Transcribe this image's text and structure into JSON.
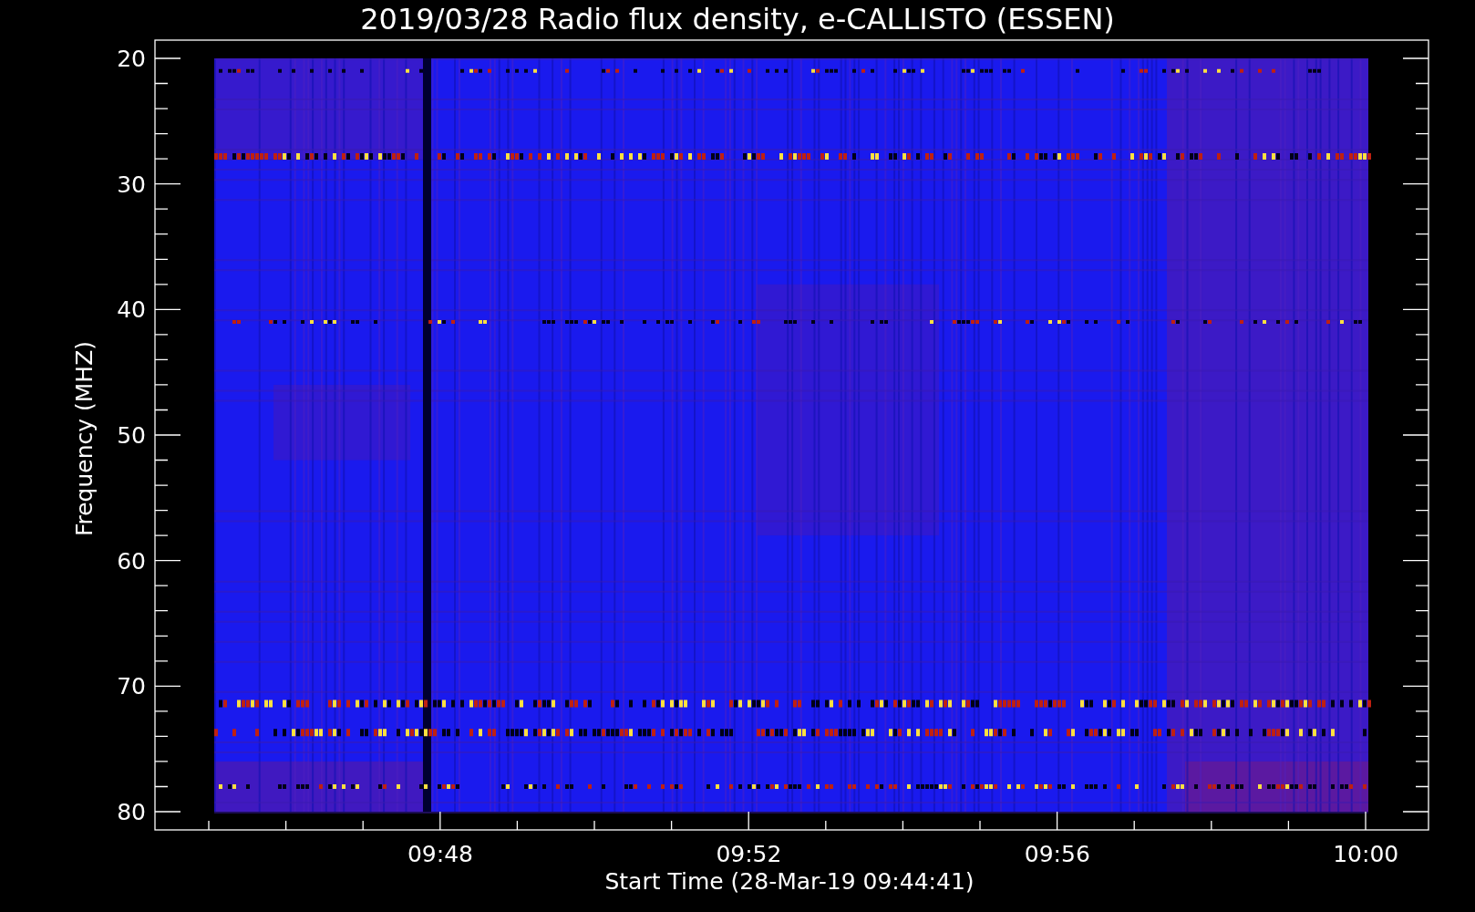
{
  "title": "2019/03/28  Radio flux density, e-CALLISTO (ESSEN)",
  "y_axis": {
    "title": "Frequency (MHZ)",
    "ticks": [
      "20",
      "30",
      "40",
      "50",
      "60",
      "70",
      "80"
    ]
  },
  "x_axis": {
    "title": "Start Time (28-Mar-19 09:44:41)",
    "ticks": [
      "09:48",
      "09:52",
      "09:56",
      "10:00"
    ]
  }
}
